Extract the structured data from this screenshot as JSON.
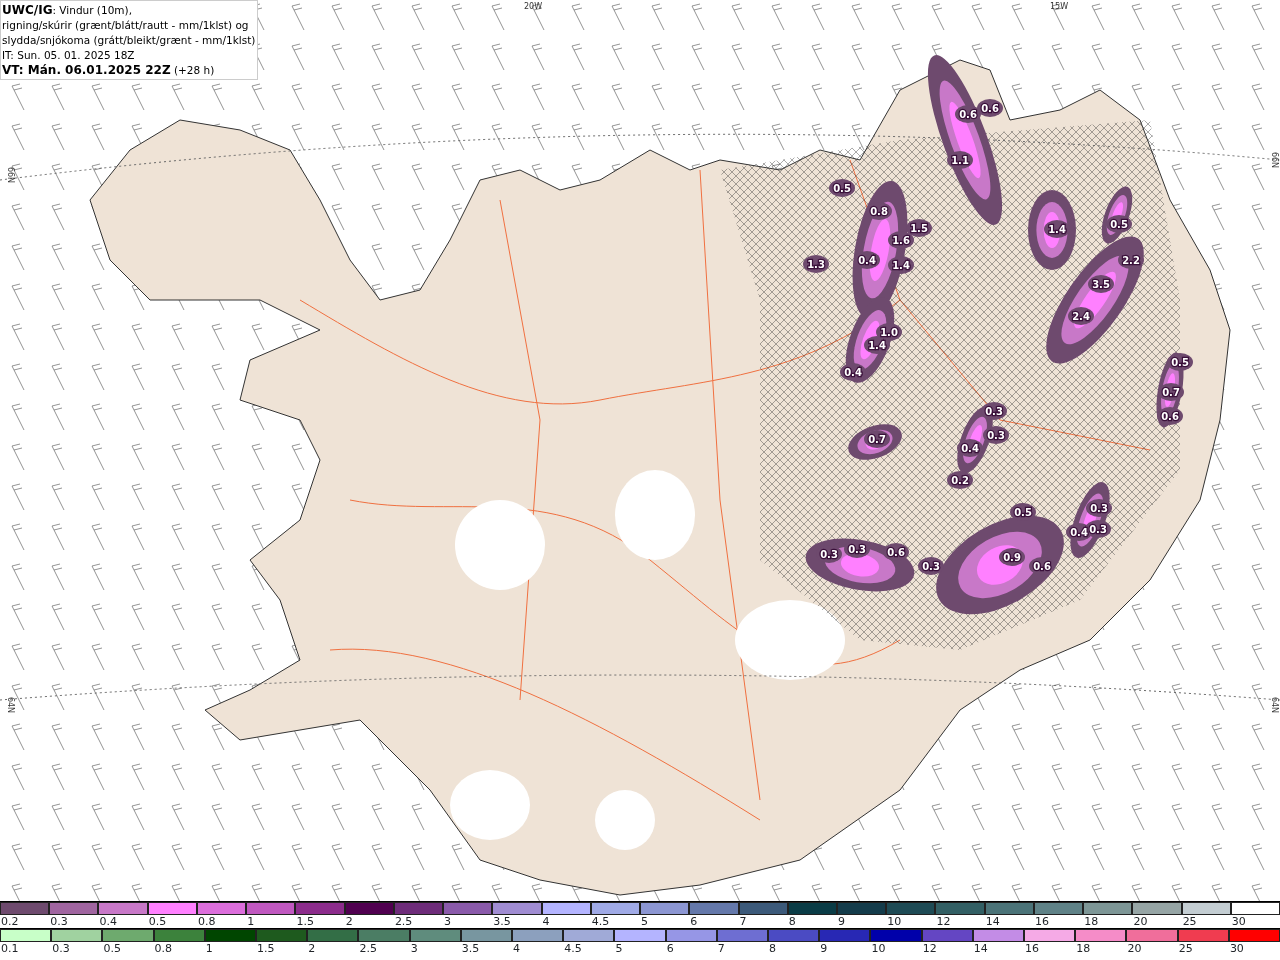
{
  "caption": {
    "lines": [
      "**UWC/IG**: Vindur (10m),",
      "rigning/skúrir (grænt/blátt/rautt - mm/1klst) og",
      "slydda/snjókoma (grátt/bleikt/grænt - mm/1klst)",
      "IT: Sun. 05. 01. 2025 18Z",
      "**VT: Mán. 06.01.2025 22Z** (+28 h)"
    ]
  },
  "map": {
    "grid_labels": [
      "20W",
      "15W",
      "66N",
      "64N",
      "66N",
      "64N"
    ],
    "precip_values": [
      "0.6",
      "0.6",
      "1.1",
      "0.5",
      "0.8",
      "1.5",
      "1.6",
      "1.4",
      "0.4",
      "1.3",
      "1.4",
      "0.5",
      "2.2",
      "3.5",
      "2.4",
      "1.0",
      "1.4",
      "0.4",
      "0.5",
      "0.7",
      "0.6",
      "0.7",
      "0.3",
      "0.3",
      "0.4",
      "0.2",
      "0.3",
      "0.3",
      "0.6",
      "0.3",
      "0.5",
      "0.9",
      "0.6",
      "0.4",
      "0.3",
      "0.3"
    ]
  },
  "legend_snow": [
    {
      "label": "0.2",
      "color": "#6e4a6e"
    },
    {
      "label": "0.3",
      "color": "#a065a0"
    },
    {
      "label": "0.4",
      "color": "#c878c8"
    },
    {
      "label": "0.5",
      "color": "#ff80ff"
    },
    {
      "label": "0.8",
      "color": "#dc6edc"
    },
    {
      "label": "1",
      "color": "#c058c0"
    },
    {
      "label": "1.5",
      "color": "#8c2c8c"
    },
    {
      "label": "2",
      "color": "#500050"
    },
    {
      "label": "2.5",
      "color": "#6e2c7a"
    },
    {
      "label": "3",
      "color": "#8a5aaa"
    },
    {
      "label": "3.5",
      "color": "#a08cd2"
    },
    {
      "label": "4",
      "color": "#b4b4ff"
    },
    {
      "label": "4.5",
      "color": "#a0aae6"
    },
    {
      "label": "5",
      "color": "#8c96d2"
    },
    {
      "label": "6",
      "color": "#6478aa"
    },
    {
      "label": "7",
      "color": "#3c5a7a"
    },
    {
      "label": "8",
      "color": "#0a3c46"
    },
    {
      "label": "9",
      "color": "#143c4b"
    },
    {
      "label": "10",
      "color": "#1e4b55"
    },
    {
      "label": "12",
      "color": "#325f64"
    },
    {
      "label": "14",
      "color": "#4b7378"
    },
    {
      "label": "16",
      "color": "#5f8287"
    },
    {
      "label": "18",
      "color": "#7d9696"
    },
    {
      "label": "20",
      "color": "#96a5a5"
    },
    {
      "label": "25",
      "color": "#c3cdd2"
    },
    {
      "label": "30",
      "color": "#ffffff"
    }
  ],
  "legend_rain": [
    {
      "label": "0.1",
      "color": "#c8ffc8"
    },
    {
      "label": "0.3",
      "color": "#a0d2a0"
    },
    {
      "label": "0.5",
      "color": "#6eaa6e"
    },
    {
      "label": "0.8",
      "color": "#3c823c"
    },
    {
      "label": "1",
      "color": "#004600"
    },
    {
      "label": "1.5",
      "color": "#1e5a1e"
    },
    {
      "label": "2",
      "color": "#336e46"
    },
    {
      "label": "2.5",
      "color": "#4b7d64"
    },
    {
      "label": "3",
      "color": "#5f8c7d"
    },
    {
      "label": "3.5",
      "color": "#7896a0"
    },
    {
      "label": "4",
      "color": "#8ca0be"
    },
    {
      "label": "4.5",
      "color": "#a0aad7"
    },
    {
      "label": "5",
      "color": "#b4b4ff"
    },
    {
      "label": "6",
      "color": "#9696e6"
    },
    {
      "label": "7",
      "color": "#6e6ed2"
    },
    {
      "label": "8",
      "color": "#4b4bc3"
    },
    {
      "label": "9",
      "color": "#2828b4"
    },
    {
      "label": "10",
      "color": "#0000aa"
    },
    {
      "label": "12",
      "color": "#6446c3"
    },
    {
      "label": "14",
      "color": "#c38ce6"
    },
    {
      "label": "16",
      "color": "#f5aae6"
    },
    {
      "label": "18",
      "color": "#f58cc8"
    },
    {
      "label": "20",
      "color": "#f06e9b"
    },
    {
      "label": "25",
      "color": "#f03c50"
    },
    {
      "label": "30",
      "color": "#ff0000"
    }
  ]
}
